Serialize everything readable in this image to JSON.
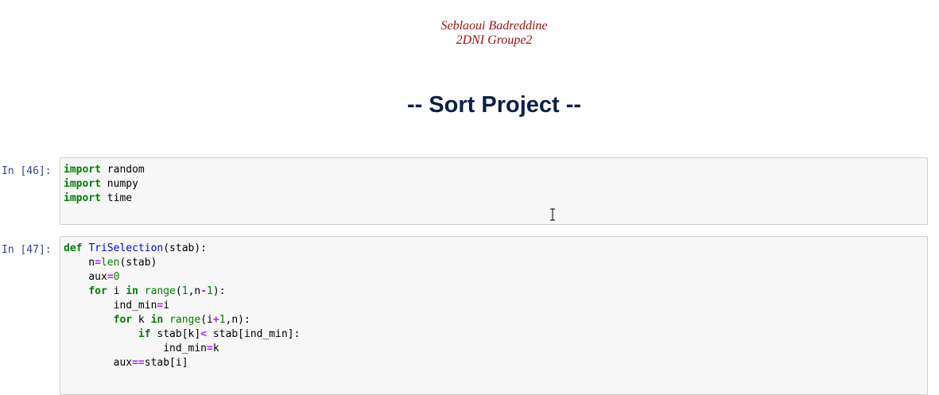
{
  "header": {
    "author_name": "Seblaoui Badreddine",
    "author_group": "2DNI Groupe2",
    "title": "-- Sort Project --"
  },
  "cells": [
    {
      "prompt": "In [46]:",
      "lines": [
        [
          [
            "kw",
            "import"
          ],
          [
            "t",
            " random"
          ]
        ],
        [
          [
            "kw",
            "import"
          ],
          [
            "t",
            " numpy"
          ]
        ],
        [
          [
            "kw",
            "import"
          ],
          [
            "t",
            " time"
          ]
        ]
      ]
    },
    {
      "prompt": "In [47]:",
      "lines": [
        [
          [
            "kw",
            "def"
          ],
          [
            "t",
            " "
          ],
          [
            "fn",
            "TriSelection"
          ],
          [
            "t",
            "(stab):"
          ]
        ],
        [
          [
            "t",
            "    n"
          ],
          [
            "op",
            "="
          ],
          [
            "bi",
            "len"
          ],
          [
            "t",
            "(stab)"
          ]
        ],
        [
          [
            "t",
            "    aux"
          ],
          [
            "op",
            "="
          ],
          [
            "num",
            "0"
          ]
        ],
        [
          [
            "t",
            "    "
          ],
          [
            "kw",
            "for"
          ],
          [
            "t",
            " i "
          ],
          [
            "kw",
            "in"
          ],
          [
            "t",
            " "
          ],
          [
            "bi",
            "range"
          ],
          [
            "t",
            "("
          ],
          [
            "num",
            "1"
          ],
          [
            "t",
            ",n"
          ],
          [
            "op",
            "-"
          ],
          [
            "num",
            "1"
          ],
          [
            "t",
            "):"
          ]
        ],
        [
          [
            "t",
            "        ind_min"
          ],
          [
            "op",
            "="
          ],
          [
            "t",
            "i"
          ]
        ],
        [
          [
            "t",
            "        "
          ],
          [
            "kw",
            "for"
          ],
          [
            "t",
            " k "
          ],
          [
            "kw",
            "in"
          ],
          [
            "t",
            " "
          ],
          [
            "bi",
            "range"
          ],
          [
            "t",
            "(i"
          ],
          [
            "op",
            "+"
          ],
          [
            "num",
            "1"
          ],
          [
            "t",
            ",n):"
          ]
        ],
        [
          [
            "t",
            "            "
          ],
          [
            "kw",
            "if"
          ],
          [
            "t",
            " stab[k]"
          ],
          [
            "op",
            "<"
          ],
          [
            "t",
            " stab[ind_min]:"
          ]
        ],
        [
          [
            "t",
            "                ind_min"
          ],
          [
            "op",
            "="
          ],
          [
            "t",
            "k"
          ]
        ],
        [
          [
            "t",
            "        aux"
          ],
          [
            "op",
            "=="
          ],
          [
            "t",
            "stab[i]"
          ]
        ]
      ]
    }
  ],
  "icons": {
    "text_cursor": "i-beam-cursor-icon"
  }
}
